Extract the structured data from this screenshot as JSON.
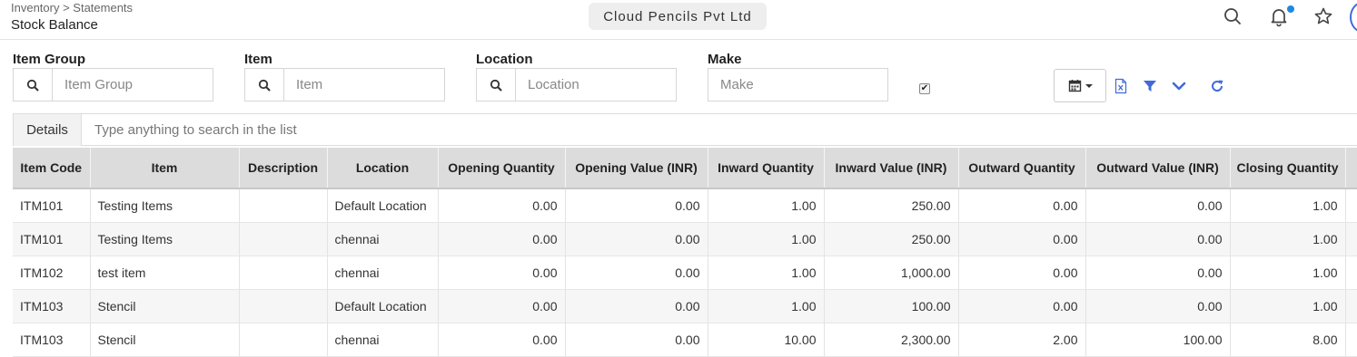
{
  "header": {
    "breadcrumb": "Inventory > Statements",
    "title": "Stock Balance",
    "company": "Cloud Pencils Pvt Ltd",
    "icons": [
      "search-icon",
      "bell-icon",
      "star-icon"
    ],
    "accent_color": "#1e88e5"
  },
  "filters": {
    "item_group": {
      "label": "Item Group",
      "placeholder": "Item Group",
      "value": ""
    },
    "item": {
      "label": "Item",
      "placeholder": "Item",
      "value": ""
    },
    "location": {
      "label": "Location",
      "placeholder": "Location",
      "value": ""
    },
    "make": {
      "label": "Make",
      "placeholder": "Make",
      "value": ""
    },
    "checkbox_checked": true
  },
  "toolbar": {
    "icons": [
      "calendar-icon",
      "excel-export-icon",
      "filter-icon",
      "chevron-down-icon",
      "refresh-icon"
    ],
    "icon_color": "#3f6ad8"
  },
  "list": {
    "tab_label": "Details",
    "search_placeholder": "Type anything to search in the list"
  },
  "table": {
    "columns": [
      "Item Code",
      "Item",
      "Description",
      "Location",
      "Opening Quantity",
      "Opening Value (INR)",
      "Inward Quantity",
      "Inward Value (INR)",
      "Outward Quantity",
      "Outward Value (INR)",
      "Closing Quantity"
    ],
    "rows": [
      [
        "ITM101",
        "Testing Items",
        "",
        "Default Location",
        "0.00",
        "0.00",
        "1.00",
        "250.00",
        "0.00",
        "0.00",
        "1.00"
      ],
      [
        "ITM101",
        "Testing Items",
        "",
        "chennai",
        "0.00",
        "0.00",
        "1.00",
        "250.00",
        "0.00",
        "0.00",
        "1.00"
      ],
      [
        "ITM102",
        "test item",
        "",
        "chennai",
        "0.00",
        "0.00",
        "1.00",
        "1,000.00",
        "0.00",
        "0.00",
        "1.00"
      ],
      [
        "ITM103",
        "Stencil",
        "",
        "Default Location",
        "0.00",
        "0.00",
        "1.00",
        "100.00",
        "0.00",
        "0.00",
        "1.00"
      ],
      [
        "ITM103",
        "Stencil",
        "",
        "chennai",
        "0.00",
        "0.00",
        "10.00",
        "2,300.00",
        "2.00",
        "100.00",
        "8.00"
      ]
    ]
  }
}
